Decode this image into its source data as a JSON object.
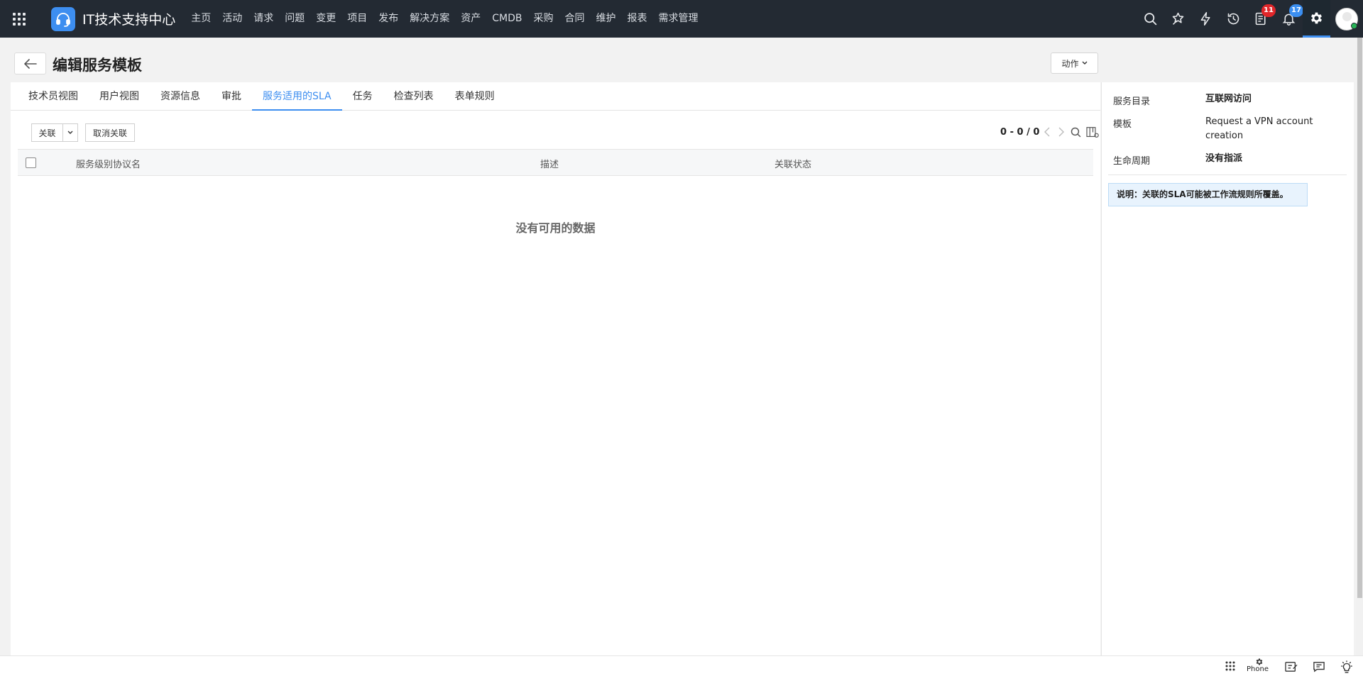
{
  "app": {
    "title": "IT技术支持中心"
  },
  "nav": {
    "items": [
      {
        "label": "主页"
      },
      {
        "label": "活动"
      },
      {
        "label": "请求"
      },
      {
        "label": "问题"
      },
      {
        "label": "变更"
      },
      {
        "label": "项目"
      },
      {
        "label": "发布"
      },
      {
        "label": "解决方案"
      },
      {
        "label": "资产"
      },
      {
        "label": "CMDB"
      },
      {
        "label": "采购"
      },
      {
        "label": "合同"
      },
      {
        "label": "维护"
      },
      {
        "label": "报表"
      },
      {
        "label": "需求管理"
      }
    ]
  },
  "topbar": {
    "icons": [
      "search-icon",
      "magic-wand-icon",
      "lightning-icon",
      "history-icon",
      "tasks-icon",
      "bell-icon",
      "gear-icon"
    ],
    "badges": {
      "tasks": "11",
      "notifications": "17"
    },
    "colors": {
      "bar": "#232a33",
      "accent": "#3d8ef0",
      "badge_red": "#e0262a",
      "badge_blue": "#3b8ff1"
    }
  },
  "page": {
    "title": "编辑服务模板",
    "actions_label": "动作"
  },
  "tabs": [
    {
      "label": "技术员视图"
    },
    {
      "label": "用户视图"
    },
    {
      "label": "资源信息"
    },
    {
      "label": "审批"
    },
    {
      "label": "服务适用的SLA",
      "active": true
    },
    {
      "label": "任务"
    },
    {
      "label": "检查列表"
    },
    {
      "label": "表单规则"
    }
  ],
  "toolbar": {
    "associate_label": "关联",
    "disassociate_label": "取消关联",
    "pagination": "0 - 0 / 0"
  },
  "table": {
    "columns": [
      "服务级别协议名",
      "描述",
      "关联状态"
    ],
    "rows": [],
    "empty_text": "没有可用的数据"
  },
  "side": {
    "fields": [
      {
        "label": "服务目录",
        "value": "互联网访问"
      },
      {
        "label": "模板",
        "value": "Request a VPN account creation"
      },
      {
        "label": "生命周期",
        "value": "没有指派"
      }
    ],
    "note": "说明：关联的SLA可能被工作流规则所覆盖。"
  },
  "footer": {
    "phone_label": "Phone",
    "icons": [
      "dialpad-icon",
      "phone-settings-icon",
      "edit-note-icon",
      "chat-icon",
      "bulb-icon"
    ]
  }
}
